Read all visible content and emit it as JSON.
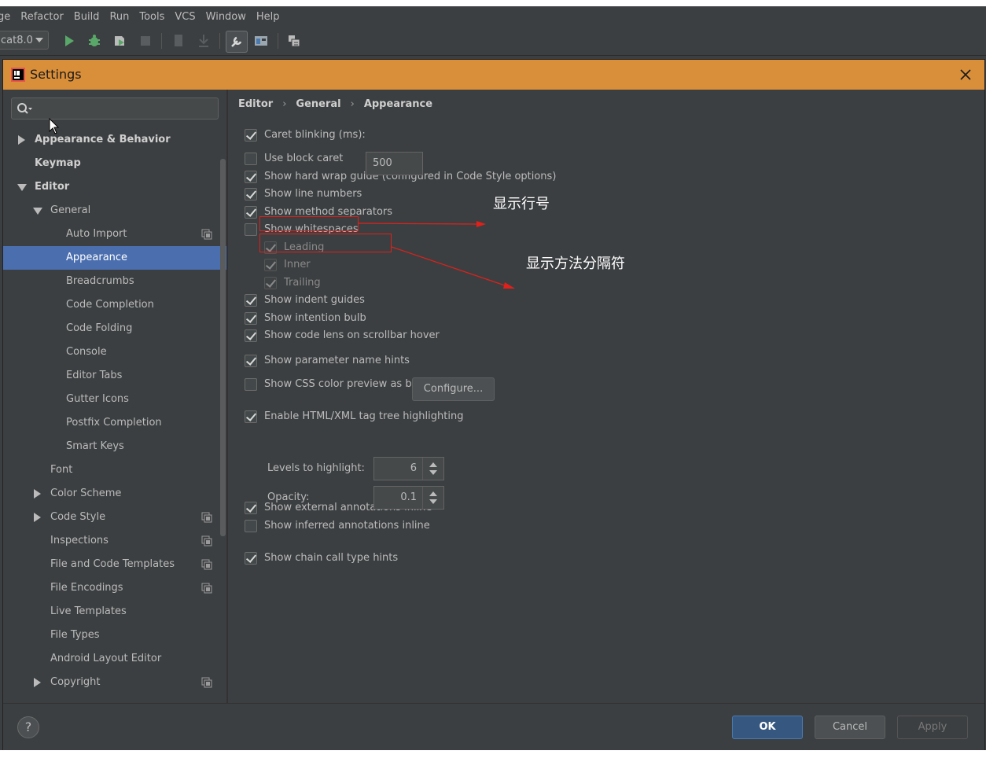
{
  "menubar": {
    "items": [
      "ge",
      "Refactor",
      "Build",
      "Run",
      "Tools",
      "VCS",
      "Window",
      "Help"
    ]
  },
  "toolbar": {
    "run_config": "cat8.0",
    "icons": [
      "run-icon",
      "debug-icon",
      "coverage-icon",
      "stop-icon",
      "bookmark-icon",
      "download-icon",
      "wrench-icon",
      "project-structure-icon",
      "sdk-manager-icon"
    ]
  },
  "dialog": {
    "title": "Settings",
    "search": {
      "value": "",
      "placeholder": ""
    }
  },
  "tree": {
    "nodes": [
      {
        "label": "Appearance & Behavior",
        "level": 0,
        "arrow": "right",
        "bold": true
      },
      {
        "label": "Keymap",
        "level": 0,
        "arrow": "none",
        "bold": true
      },
      {
        "label": "Editor",
        "level": 0,
        "arrow": "down",
        "bold": true
      },
      {
        "label": "General",
        "level": 1,
        "arrow": "down"
      },
      {
        "label": "Auto Import",
        "level": 2,
        "arrow": "none",
        "project": true
      },
      {
        "label": "Appearance",
        "level": 2,
        "arrow": "none",
        "selected": true
      },
      {
        "label": "Breadcrumbs",
        "level": 2,
        "arrow": "none"
      },
      {
        "label": "Code Completion",
        "level": 2,
        "arrow": "none"
      },
      {
        "label": "Code Folding",
        "level": 2,
        "arrow": "none"
      },
      {
        "label": "Console",
        "level": 2,
        "arrow": "none"
      },
      {
        "label": "Editor Tabs",
        "level": 2,
        "arrow": "none"
      },
      {
        "label": "Gutter Icons",
        "level": 2,
        "arrow": "none"
      },
      {
        "label": "Postfix Completion",
        "level": 2,
        "arrow": "none"
      },
      {
        "label": "Smart Keys",
        "level": 2,
        "arrow": "none"
      },
      {
        "label": "Font",
        "level": 1,
        "arrow": "none"
      },
      {
        "label": "Color Scheme",
        "level": 1,
        "arrow": "right"
      },
      {
        "label": "Code Style",
        "level": 1,
        "arrow": "right",
        "project": true
      },
      {
        "label": "Inspections",
        "level": 1,
        "arrow": "none",
        "project": true
      },
      {
        "label": "File and Code Templates",
        "level": 1,
        "arrow": "none",
        "project": true
      },
      {
        "label": "File Encodings",
        "level": 1,
        "arrow": "none",
        "project": true
      },
      {
        "label": "Live Templates",
        "level": 1,
        "arrow": "none"
      },
      {
        "label": "File Types",
        "level": 1,
        "arrow": "none"
      },
      {
        "label": "Android Layout Editor",
        "level": 1,
        "arrow": "none"
      },
      {
        "label": "Copyright",
        "level": 1,
        "arrow": "right",
        "project": true
      }
    ]
  },
  "breadcrumb": [
    "Editor",
    "General",
    "Appearance"
  ],
  "options": [
    {
      "label": "Caret blinking (ms):",
      "checked": true
    },
    {
      "label": "Use block caret",
      "checked": false
    },
    {
      "label": "Show hard wrap guide (configured in Code Style options)",
      "checked": true
    },
    {
      "label": "Show line numbers",
      "checked": true
    },
    {
      "label": "Show method separators",
      "checked": true
    },
    {
      "label": "Show whitespaces",
      "checked": false
    },
    {
      "label": "Leading",
      "checked": true,
      "disabled": true
    },
    {
      "label": "Inner",
      "checked": true,
      "disabled": true
    },
    {
      "label": "Trailing",
      "checked": true,
      "disabled": true
    },
    {
      "label": "Show indent guides",
      "checked": true
    },
    {
      "label": "Show intention bulb",
      "checked": true
    },
    {
      "label": "Show code lens on scrollbar hover",
      "checked": true
    },
    {
      "label": "Show parameter name hints",
      "checked": true
    },
    {
      "label": "Show CSS color preview as background",
      "checked": false
    },
    {
      "label": "Enable HTML/XML tag tree highlighting",
      "checked": true
    },
    {
      "label": "Show external annotations inline",
      "checked": true
    },
    {
      "label": "Show inferred annotations inline",
      "checked": false
    },
    {
      "label": "Show chain call type hints",
      "checked": true
    }
  ],
  "caret_blinking_value": "500",
  "configure_label": "Configure...",
  "levels": {
    "label": "Levels to highlight:",
    "value": "6"
  },
  "opacity": {
    "label": "Opacity:",
    "value": "0.1"
  },
  "annotations": {
    "line_numbers": "显示行号",
    "method_separators": "显示方法分隔符",
    "color": "#e0201a"
  },
  "buttons": {
    "ok": "OK",
    "cancel": "Cancel",
    "apply": "Apply",
    "help": "?"
  },
  "colors": {
    "title_bar": "#d98e3a",
    "selection": "#4b6eaf",
    "primary_button": "#365880"
  }
}
